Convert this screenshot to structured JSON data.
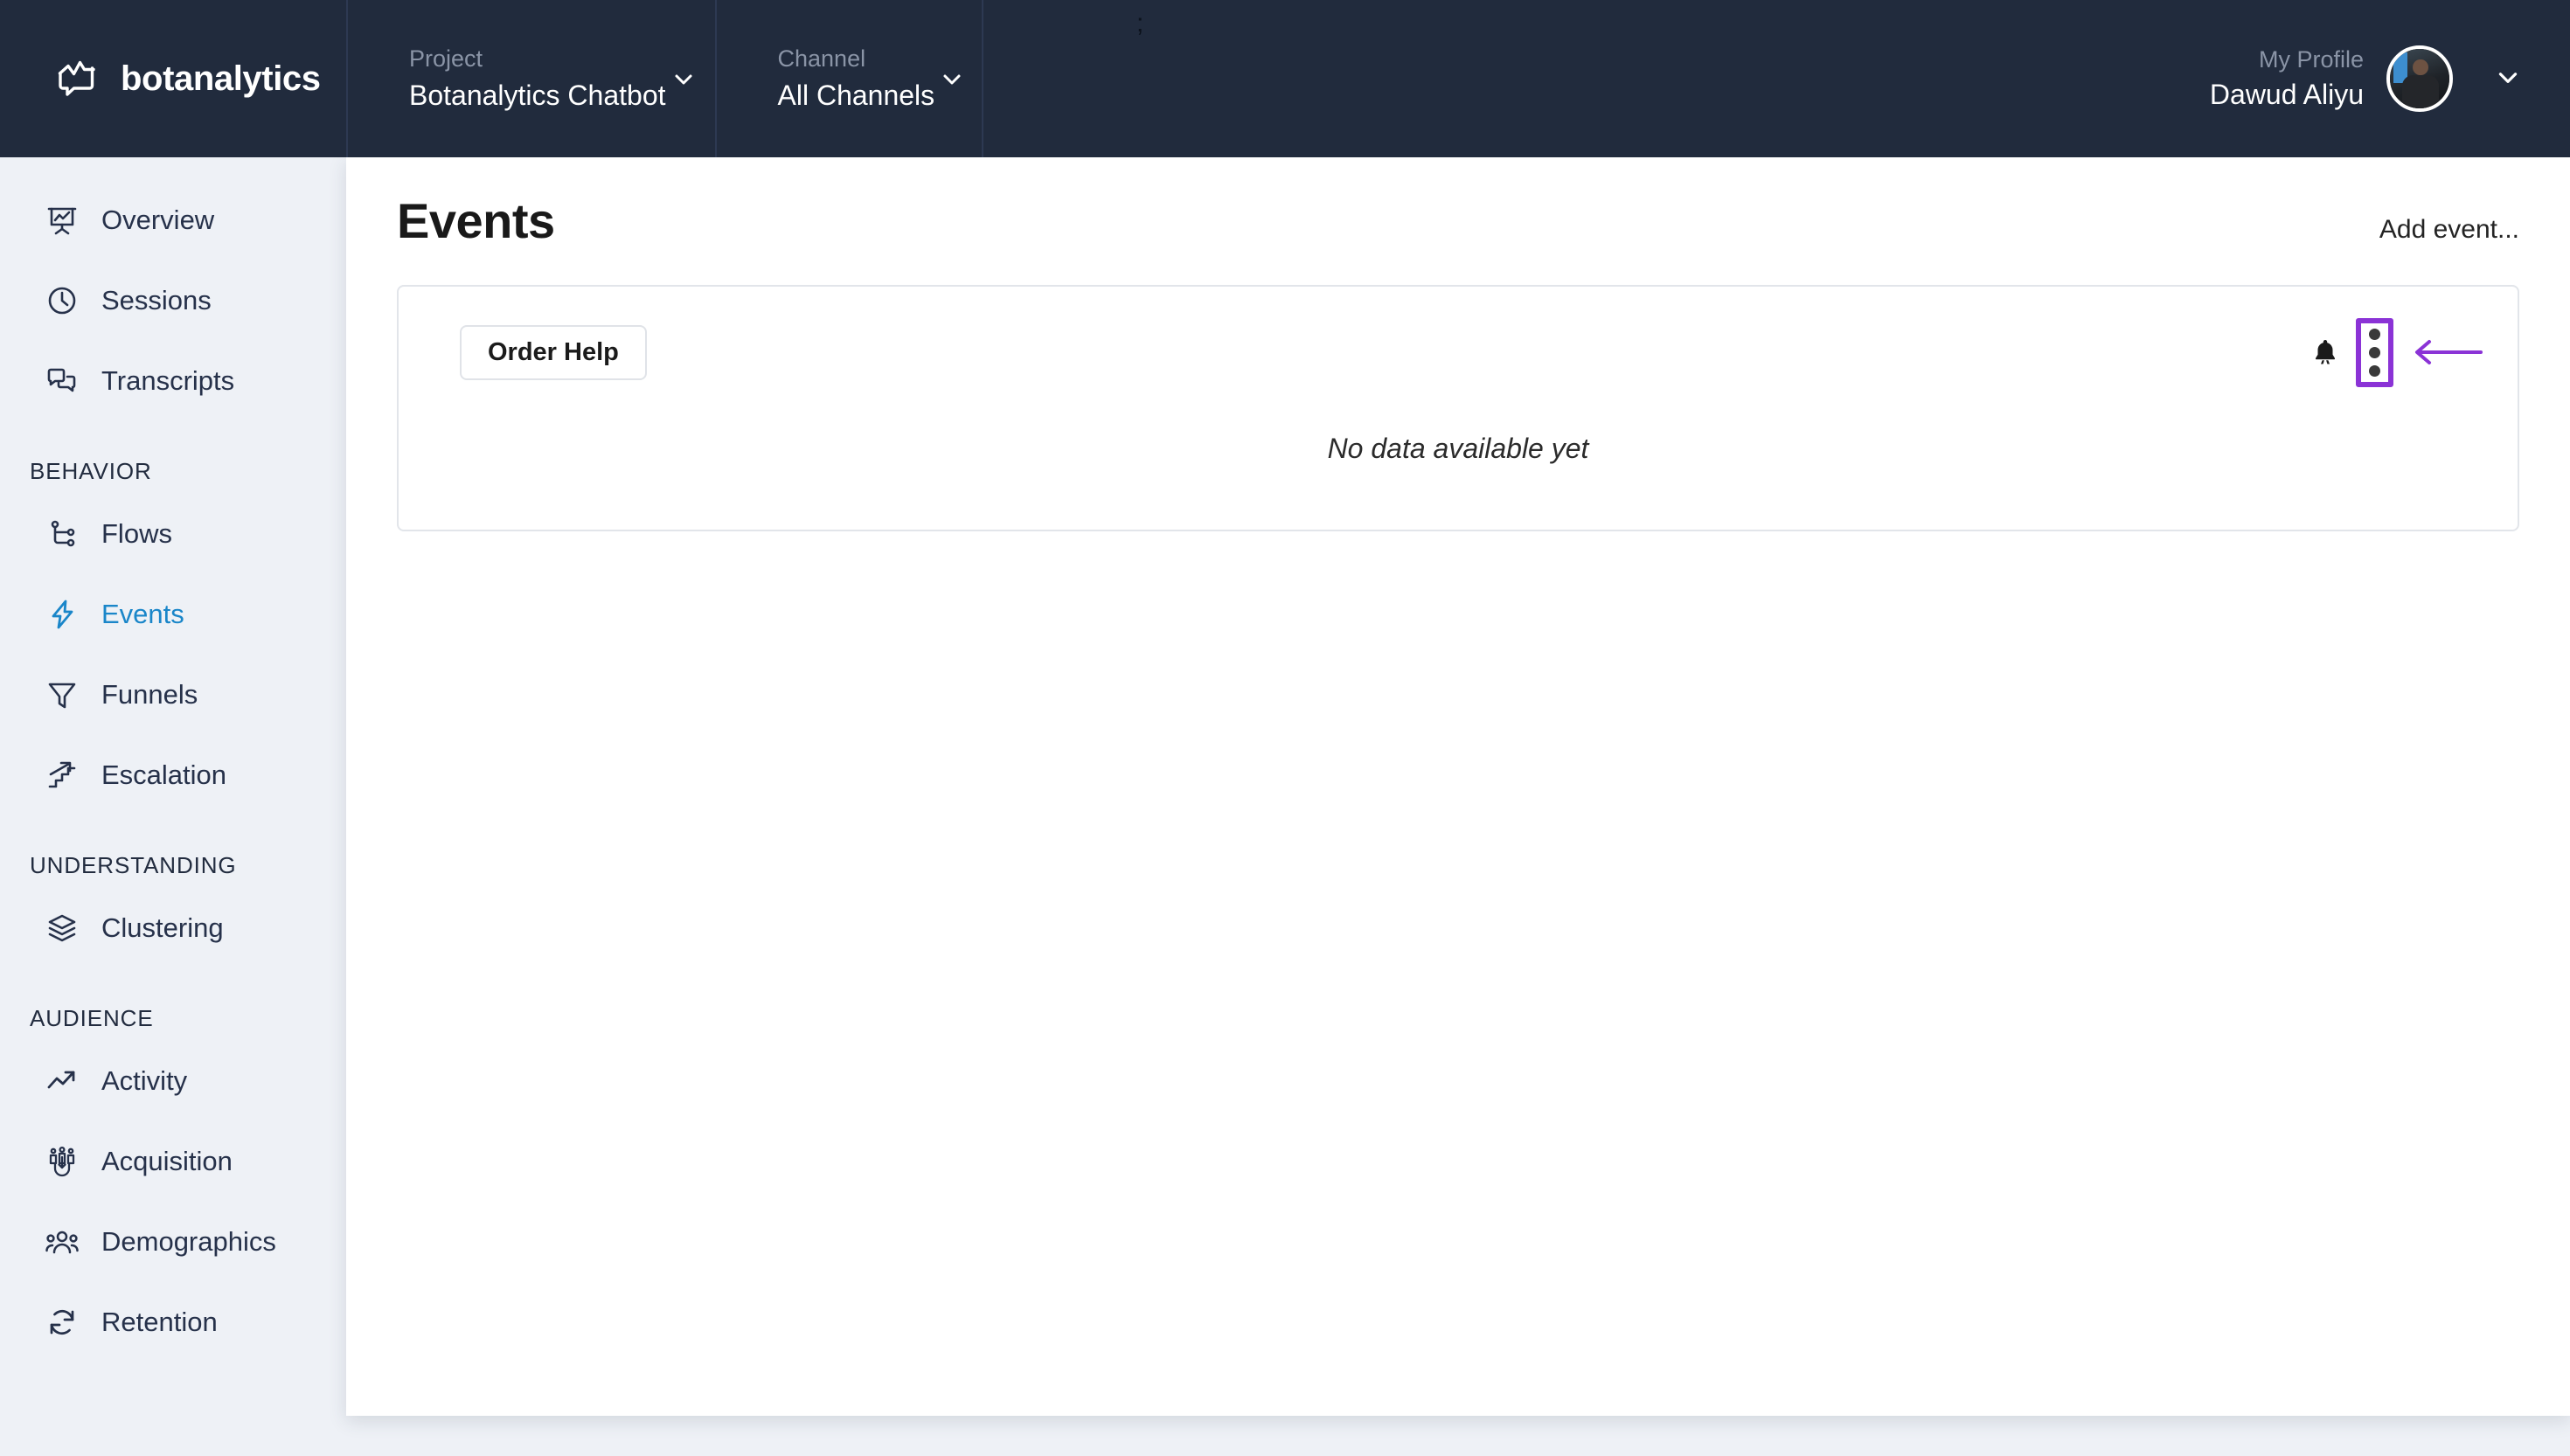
{
  "brand": {
    "name": "botanalytics",
    "logo_icon": "chat-chart-logo-icon"
  },
  "header": {
    "project": {
      "label": "Project",
      "value": "Botanalytics Chatbot",
      "caret_icon": "chevron-down-icon"
    },
    "channel": {
      "label": "Channel",
      "value": "All Channels",
      "caret_icon": "chevron-down-icon"
    },
    "profile": {
      "label": "My Profile",
      "name": "Dawud Aliyu",
      "avatar_icon": "user-avatar",
      "caret_icon": "chevron-down-icon"
    },
    "caret_mark": ";"
  },
  "sidebar": {
    "items": [
      {
        "label": "Overview",
        "icon": "presentation-chart-icon",
        "active": false
      },
      {
        "label": "Sessions",
        "icon": "clock-icon",
        "active": false
      },
      {
        "label": "Transcripts",
        "icon": "chat-bubbles-icon",
        "active": false
      }
    ],
    "groups": [
      {
        "title": "BEHAVIOR",
        "items": [
          {
            "label": "Flows",
            "icon": "flow-branch-icon",
            "active": false
          },
          {
            "label": "Events",
            "icon": "lightning-bolt-icon",
            "active": true
          },
          {
            "label": "Funnels",
            "icon": "funnel-icon",
            "active": false
          },
          {
            "label": "Escalation",
            "icon": "stairs-arrow-icon",
            "active": false
          }
        ]
      },
      {
        "title": "UNDERSTANDING",
        "items": [
          {
            "label": "Clustering",
            "icon": "layers-icon",
            "active": false
          }
        ]
      },
      {
        "title": "AUDIENCE",
        "items": [
          {
            "label": "Activity",
            "icon": "trend-arrow-icon",
            "active": false
          },
          {
            "label": "Acquisition",
            "icon": "magnet-people-icon",
            "active": false
          },
          {
            "label": "Demographics",
            "icon": "people-group-icon",
            "active": false
          },
          {
            "label": "Retention",
            "icon": "refresh-cycle-icon",
            "active": false
          }
        ]
      }
    ]
  },
  "main": {
    "title": "Events",
    "add_event_label": "Add event...",
    "card": {
      "chip_label": "Order Help",
      "empty_text": "No data available yet",
      "bell_icon": "bell-icon",
      "kebab_icon": "kebab-menu-icon",
      "annotation_icon": "left-arrow-annotation-icon"
    }
  },
  "colors": {
    "header_bg": "#212b3d",
    "sidebar_bg": "#eef1f6",
    "accent_active": "#1a86c9",
    "annotation_purple": "#8b33d6",
    "text_dark": "#26314a"
  }
}
